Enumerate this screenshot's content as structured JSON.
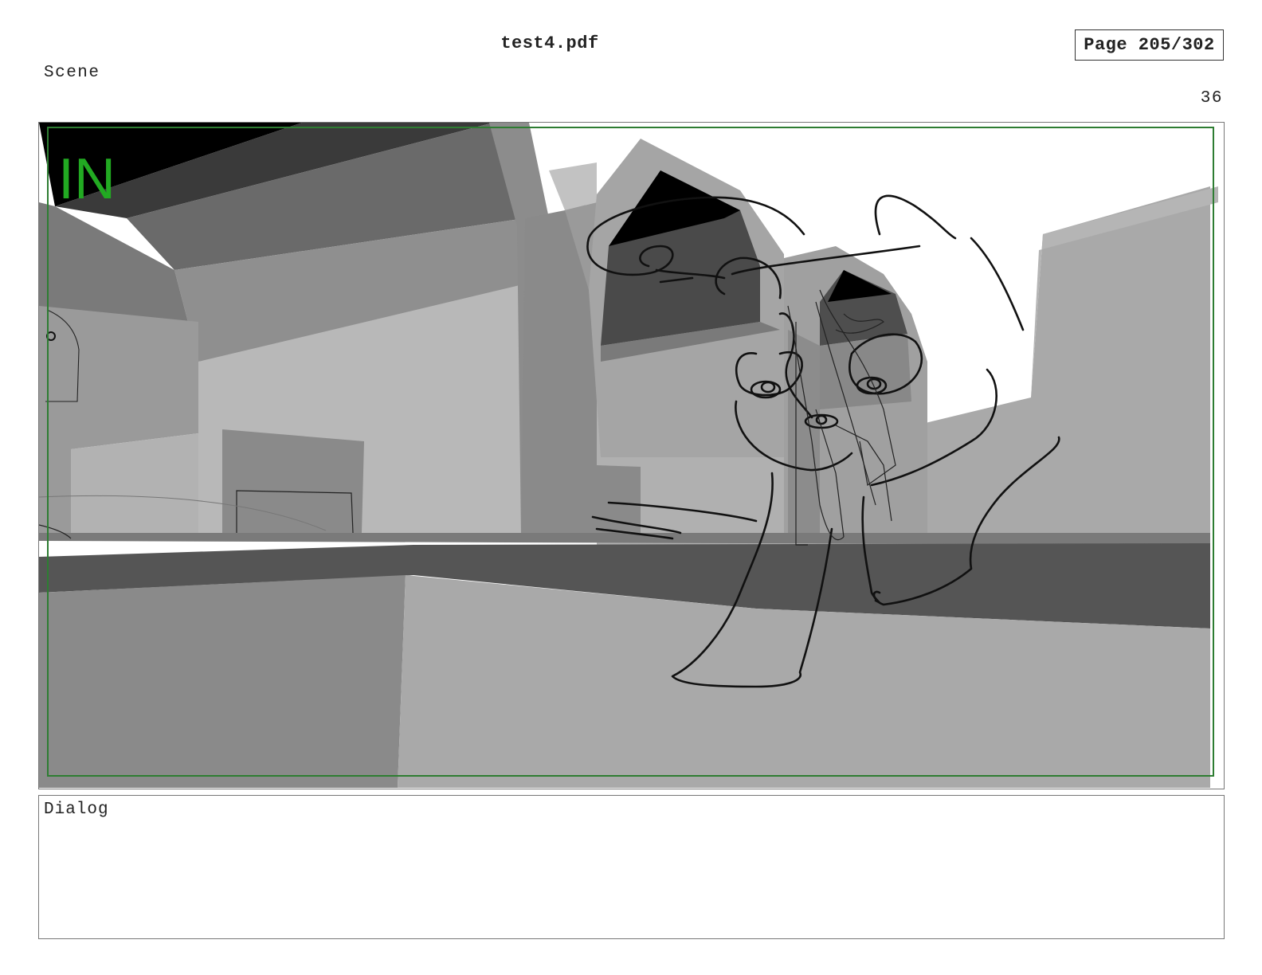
{
  "document": {
    "title": "test4.pdf",
    "page_indicator": "Page 205/302"
  },
  "scene": {
    "label": "Scene",
    "number": "36"
  },
  "panel": {
    "overlay_text": "IN",
    "overlay_color": "#22aa22",
    "safe_frame_color": "#2e7d32"
  },
  "dialog": {
    "label": "Dialog"
  }
}
